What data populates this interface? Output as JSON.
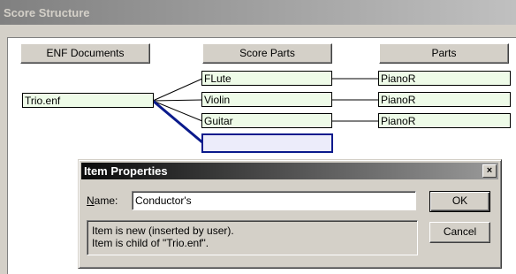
{
  "window": {
    "title": "Score Structure"
  },
  "columns": {
    "enf_documents": "ENF Documents",
    "score_parts": "Score Parts",
    "parts": "Parts"
  },
  "tree": {
    "document": "Trio.enf",
    "score_parts": [
      "FLute",
      "Violin",
      "Guitar",
      ""
    ],
    "parts": [
      "PianoR",
      "PianoR",
      "PianoR"
    ]
  },
  "dialog": {
    "title": "Item Properties",
    "close_glyph": "×",
    "name_label_accel": "N",
    "name_label_rest": "ame:",
    "name_value": "Conductor's",
    "info_line1": "Item is new (inserted by user).",
    "info_line2": "Item is child of \"Trio.enf\".",
    "ok_label": "OK",
    "cancel_label": "Cancel"
  }
}
